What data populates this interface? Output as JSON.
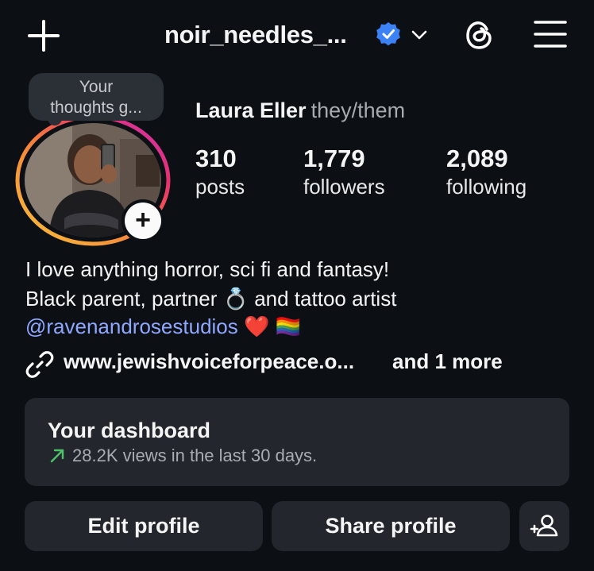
{
  "header": {
    "username": "noir_needles_...",
    "icons": [
      "plus-icon",
      "verified-badge-icon",
      "chevron-down-icon",
      "threads-icon",
      "menu-icon"
    ]
  },
  "note": {
    "text_line1": "Your",
    "text_line2": "thoughts g..."
  },
  "profile": {
    "name": "Laura Eller",
    "pronouns": "they/them",
    "add_story_label": "+"
  },
  "stats": [
    {
      "value": "310",
      "label": "posts"
    },
    {
      "value": "1,779",
      "label": "followers"
    },
    {
      "value": "2,089",
      "label": "following"
    }
  ],
  "bio": {
    "line1": "I love anything horror, sci fi and fantasy!",
    "line2_before": "Black parent, partner",
    "line2_emoji": "💍",
    "line2_after": "and tattoo artist",
    "line3_mention": "@ravenandrosestudios",
    "line3_emoji": "❤️ 🏳️‍🌈"
  },
  "links": {
    "website": "www.jewishvoiceforpeace.o...",
    "more": "and 1 more"
  },
  "dashboard": {
    "title": "Your dashboard",
    "subtitle": "28.2K views in the last 30 days."
  },
  "buttons": {
    "edit": "Edit profile",
    "share": "Share profile"
  },
  "colors": {
    "background": "#0c0f14",
    "card": "#23262c",
    "verified": "#3b82f6",
    "mention": "#8fa8ff",
    "trend_up": "#4cc36b"
  }
}
